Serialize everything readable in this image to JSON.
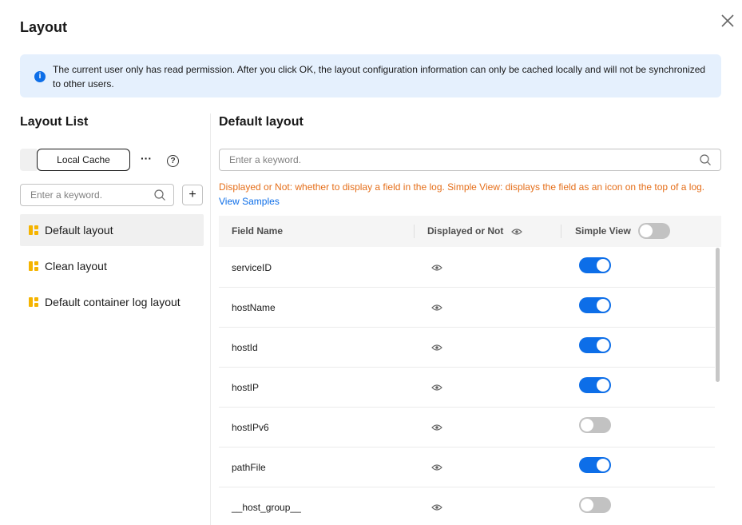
{
  "dialog": {
    "title": "Layout",
    "close_icon": "close-icon"
  },
  "notice": {
    "icon": "info-icon",
    "text": "The current user only has read permission. After you click OK, the layout configuration information can only be cached locally and will not be synchronized to other users."
  },
  "left_panel": {
    "title": "Layout List",
    "local_cache_label": "Local Cache",
    "more_label": "···",
    "help_label": "?",
    "search_placeholder": "Enter a keyword.",
    "add_label": "+",
    "layouts": [
      {
        "label": "Default layout",
        "active": true
      },
      {
        "label": "Clean layout",
        "active": false
      },
      {
        "label": "Default container log layout",
        "active": false
      }
    ]
  },
  "right_panel": {
    "title": "Default layout",
    "search_placeholder": "Enter a keyword.",
    "hint": "Displayed or Not: whether to display a field in the log. Simple View: displays the field as an icon on the top of a log.",
    "view_samples": "View Samples",
    "columns": {
      "field_name": "Field Name",
      "displayed": "Displayed or Not",
      "simple_view": "Simple View"
    },
    "header_simple_view_on": false,
    "rows": [
      {
        "field": "serviceID",
        "displayed": true,
        "simple_view": true
      },
      {
        "field": "hostName",
        "displayed": true,
        "simple_view": true
      },
      {
        "field": "hostId",
        "displayed": true,
        "simple_view": true
      },
      {
        "field": "hostIP",
        "displayed": true,
        "simple_view": true
      },
      {
        "field": "hostIPv6",
        "displayed": true,
        "simple_view": false
      },
      {
        "field": "pathFile",
        "displayed": true,
        "simple_view": true
      },
      {
        "field": "__host_group__",
        "displayed": true,
        "simple_view": false
      }
    ]
  },
  "colors": {
    "accent": "#0d6ee8",
    "warning_text": "#e56e19",
    "notice_bg": "#e5f0fd",
    "layout_icon": "#f5b400"
  }
}
